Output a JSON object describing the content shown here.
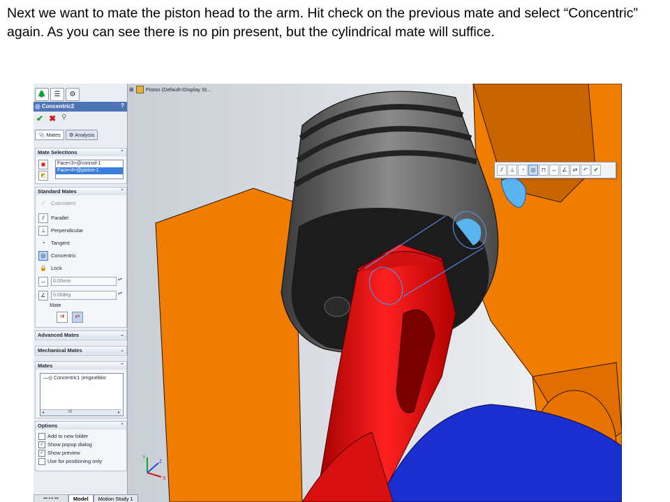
{
  "caption": "Next we want to mate the piston head to the arm. Hit check on the previous mate and select “Concentric” again. As you can see there is no pin present, but the cylindrical mate will suffice.",
  "property_manager": {
    "title": "Concentric2",
    "help": "?",
    "subtabs": [
      "Mates",
      "Analysis"
    ],
    "mate_selections": {
      "header": "Mate Selections",
      "items": [
        "Face<3>@conrod-1",
        "Face<4>@piston-1"
      ]
    },
    "standard_mates": {
      "header": "Standard Mates",
      "items": [
        "Coincident",
        "Parallel",
        "Perpendicular",
        "Tangent",
        "Concentric",
        "Lock"
      ],
      "distance": "0.00mm",
      "angle": "0.00deg",
      "mate_label": "Mate"
    },
    "advanced_mates": {
      "header": "Advanced Mates"
    },
    "mechanical_mates": {
      "header": "Mechanical Mates"
    },
    "mates": {
      "header": "Mates",
      "items": [
        "Concentric1 (enginebloc"
      ],
      "scroll_thumb": "III"
    },
    "options": {
      "header": "Options",
      "items": [
        {
          "label": "Add to new folder",
          "checked": false
        },
        {
          "label": "Show popup dialog",
          "checked": true
        },
        {
          "label": "Show preview",
          "checked": true
        },
        {
          "label": "Use for positioning only",
          "checked": false
        }
      ]
    }
  },
  "viewport": {
    "header": "Piston (Default<Display St...",
    "popup_toolbar": [
      "parallel",
      "perpendicular",
      "tangent",
      "concentric",
      "lock",
      "distance",
      "angle",
      "flip",
      "undo",
      "ok"
    ]
  },
  "bottom_tabs": [
    "Model",
    "Motion Study 1"
  ],
  "colors": {
    "block_orange": "#f07c00",
    "rod_red": "#e01010",
    "piston_gray": "#6b6b6b",
    "bearing_blue": "#1b2fd0",
    "highlight_blue": "#5ab4f0",
    "pm_title_blue": "#4e74b8"
  },
  "axes": {
    "x": "X",
    "y": "Y",
    "z": "Z"
  }
}
